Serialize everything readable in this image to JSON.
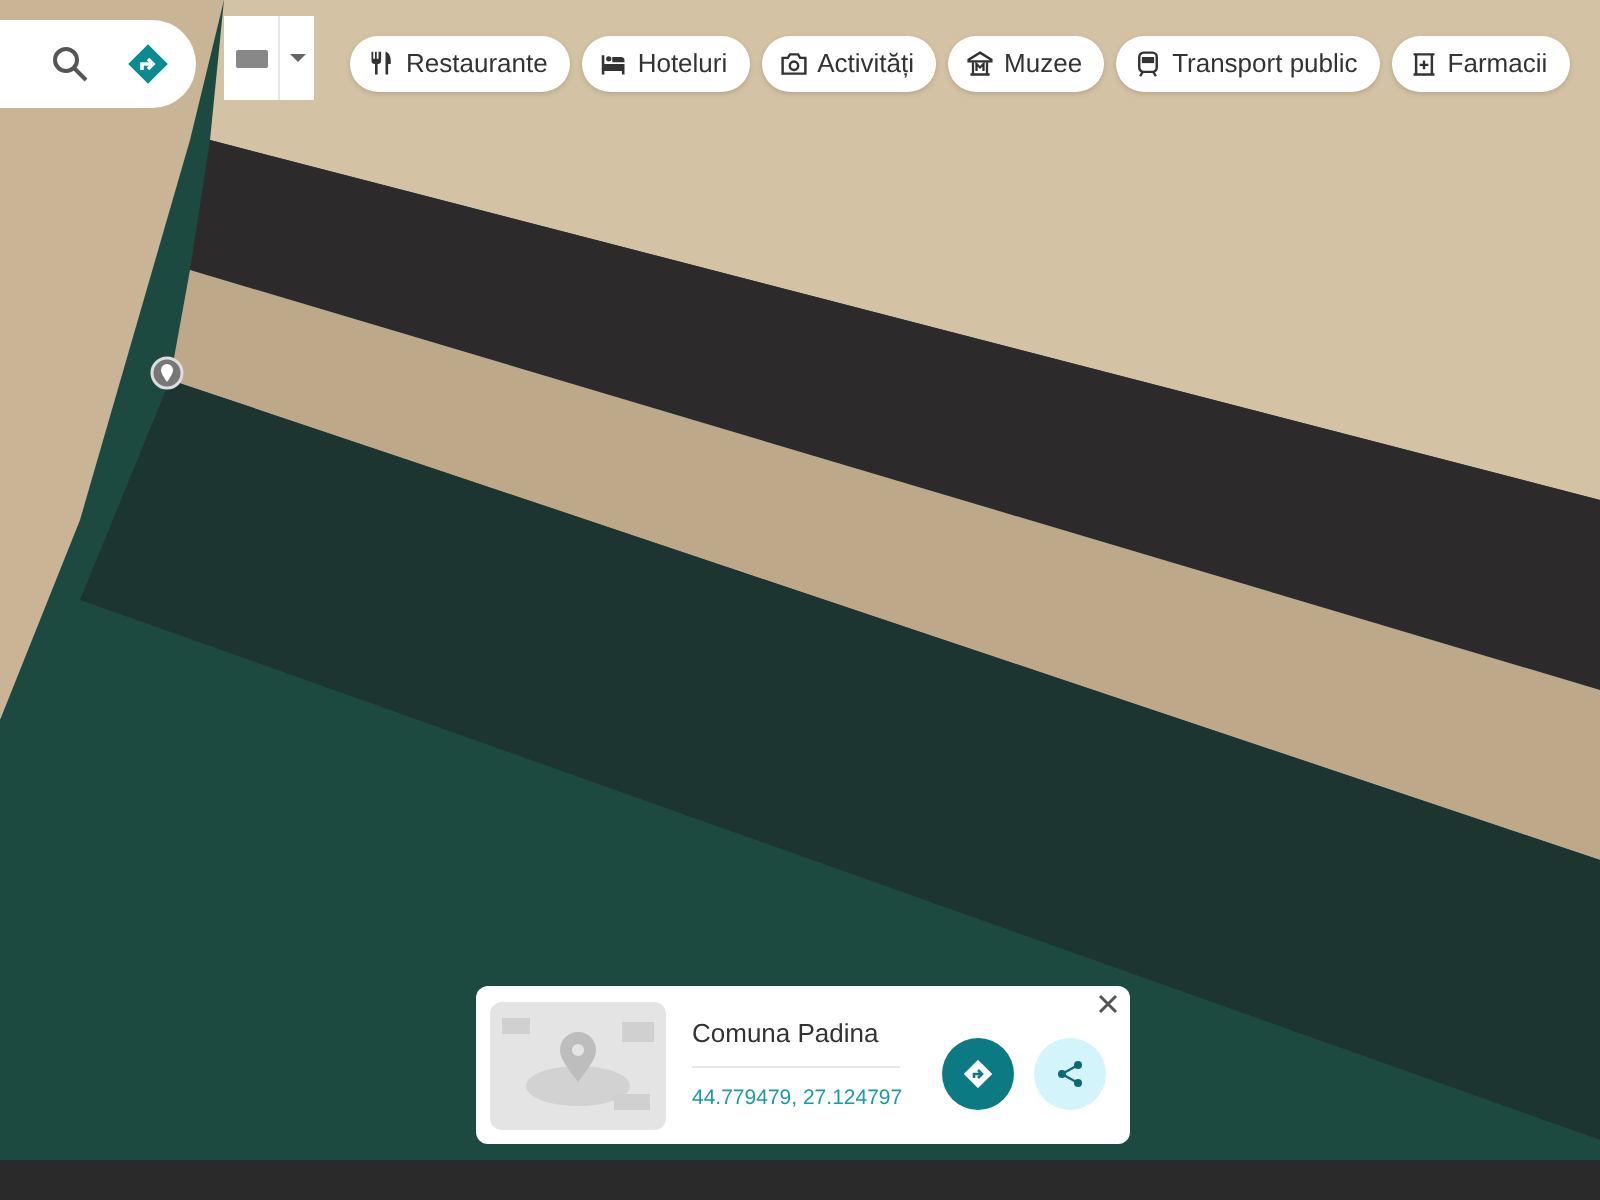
{
  "categories": [
    {
      "kind": "restaurant",
      "label": "Restaurante"
    },
    {
      "kind": "hotel",
      "label": "Hoteluri"
    },
    {
      "kind": "camera",
      "label": "Activități"
    },
    {
      "kind": "museum",
      "label": "Muzee"
    },
    {
      "kind": "transit",
      "label": "Transport public"
    },
    {
      "kind": "pharmacy",
      "label": "Farmacii"
    }
  ],
  "place_card": {
    "title": "Comuna Padina",
    "coordinates": "44.779479, 27.124797"
  }
}
